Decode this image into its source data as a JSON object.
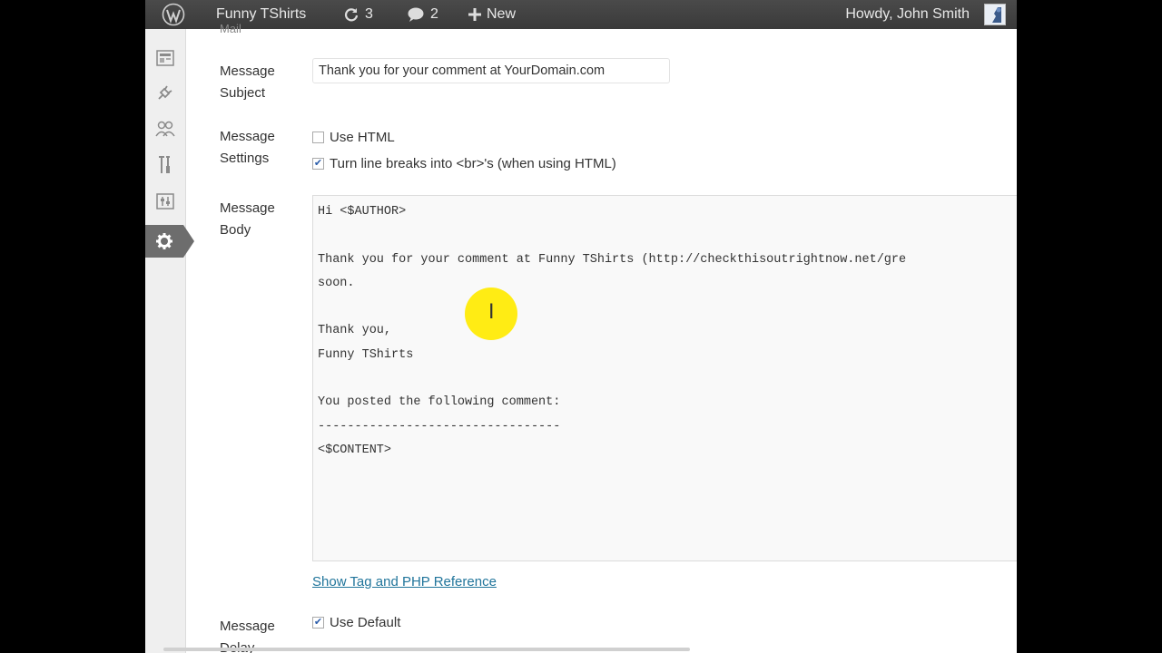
{
  "adminbar": {
    "site_name": "Funny TShirts",
    "updates_count": "3",
    "comments_count": "2",
    "new_label": "New",
    "howdy": "Howdy, John Smith"
  },
  "sidebar": {
    "icons": [
      "dashboard-icon",
      "plugins-icon",
      "users-icon",
      "tools-icon",
      "settings-sliders-icon",
      "settings-gear-icon"
    ],
    "active": "settings-gear-icon",
    "active_color": "#6d6d6d"
  },
  "form": {
    "cut_label": "Mail",
    "subject_label_1": "Message",
    "subject_label_2": "Subject",
    "subject_value": "Thank you for your comment at YourDomain.com",
    "settings_label_1": "Message",
    "settings_label_2": "Settings",
    "use_html_label": "Use HTML",
    "use_html_checked": false,
    "linebreaks_label": "Turn line breaks into <br>'s (when using HTML)",
    "linebreaks_checked": true,
    "body_label_1": "Message",
    "body_label_2": "Body",
    "body_value": "Hi <$AUTHOR>\n\nThank you for your comment at Funny TShirts (http://checkthisoutrightnow.net/gre\nsoon.\n\nThank you,\nFunny TShirts\n\nYou posted the following comment:\n---------------------------------\n<$CONTENT>",
    "reference_link": "Show Tag and PHP Reference",
    "delay_label_1": "Message",
    "delay_label_2": "Delay",
    "use_default_label": "Use Default",
    "use_default_checked": true
  },
  "colors": {
    "adminbar_bg": "#464646",
    "link": "#21759b",
    "cursor_highlight": "#ffea00"
  }
}
